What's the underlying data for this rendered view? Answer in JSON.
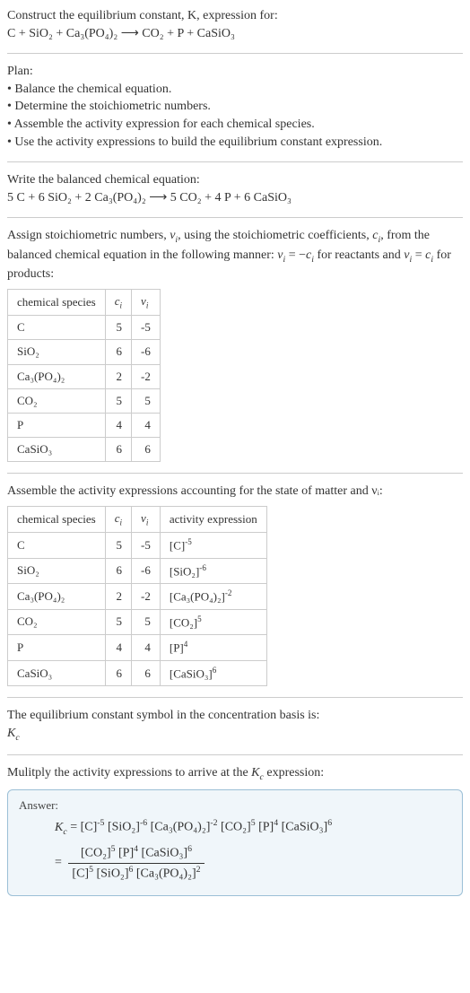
{
  "intro": {
    "line1": "Construct the equilibrium constant, K, expression for:",
    "eq": "C + SiO₂ + Ca₃(PO₄)₂  ⟶  CO₂ + P + CaSiO₃"
  },
  "plan": {
    "title": "Plan:",
    "items": [
      "• Balance the chemical equation.",
      "• Determine the stoichiometric numbers.",
      "• Assemble the activity expression for each chemical species.",
      "• Use the activity expressions to build the equilibrium constant expression."
    ]
  },
  "balanced": {
    "title": "Write the balanced chemical equation:",
    "eq": "5 C + 6 SiO₂ + 2 Ca₃(PO₄)₂  ⟶  5 CO₂ + 4 P + 6 CaSiO₃"
  },
  "stoich": {
    "desc_a": "Assign stoichiometric numbers, ",
    "desc_b": ", using the stoichiometric coefficients, ",
    "desc_c": ", from the balanced chemical equation in the following manner: ",
    "desc_d": " for reactants and ",
    "desc_e": " for products:",
    "headers": {
      "species": "chemical species",
      "ci": "cᵢ",
      "vi": "νᵢ"
    },
    "rows": [
      {
        "sp": "C",
        "c": "5",
        "v": "-5"
      },
      {
        "sp": "SiO₂",
        "c": "6",
        "v": "-6"
      },
      {
        "sp": "Ca₃(PO₄)₂",
        "c": "2",
        "v": "-2"
      },
      {
        "sp": "CO₂",
        "c": "5",
        "v": "5"
      },
      {
        "sp": "P",
        "c": "4",
        "v": "4"
      },
      {
        "sp": "CaSiO₃",
        "c": "6",
        "v": "6"
      }
    ]
  },
  "activity": {
    "desc": "Assemble the activity expressions accounting for the state of matter and νᵢ:",
    "headers": {
      "species": "chemical species",
      "ci": "cᵢ",
      "vi": "νᵢ",
      "act": "activity expression"
    },
    "rows": [
      {
        "sp": "C",
        "c": "5",
        "v": "-5",
        "a_base": "[C]",
        "a_exp": "-5"
      },
      {
        "sp": "SiO₂",
        "c": "6",
        "v": "-6",
        "a_base": "[SiO₂]",
        "a_exp": "-6"
      },
      {
        "sp": "Ca₃(PO₄)₂",
        "c": "2",
        "v": "-2",
        "a_base": "[Ca₃(PO₄)₂]",
        "a_exp": "-2"
      },
      {
        "sp": "CO₂",
        "c": "5",
        "v": "5",
        "a_base": "[CO₂]",
        "a_exp": "5"
      },
      {
        "sp": "P",
        "c": "4",
        "v": "4",
        "a_base": "[P]",
        "a_exp": "4"
      },
      {
        "sp": "CaSiO₃",
        "c": "6",
        "v": "6",
        "a_base": "[CaSiO₃]",
        "a_exp": "6"
      }
    ]
  },
  "symbol": {
    "line1": "The equilibrium constant symbol in the concentration basis is:",
    "line2": "K꜀"
  },
  "final": {
    "title": "Mulitply the activity expressions to arrive at the K꜀ expression:",
    "answer_label": "Answer:",
    "kc": "K꜀ = ",
    "prod": {
      "t1": "[C]",
      "e1": "-5",
      "t2": "[SiO₂]",
      "e2": "-6",
      "t3": "[Ca₃(PO₄)₂]",
      "e3": "-2",
      "t4": "[CO₂]",
      "e4": "5",
      "t5": "[P]",
      "e5": "4",
      "t6": "[CaSiO₃]",
      "e6": "6"
    },
    "frac": {
      "num": {
        "t1": "[CO₂]",
        "e1": "5",
        "t2": "[P]",
        "e2": "4",
        "t3": "[CaSiO₃]",
        "e3": "6"
      },
      "den": {
        "t1": "[C]",
        "e1": "5",
        "t2": "[SiO₂]",
        "e2": "6",
        "t3": "[Ca₃(PO₄)₂]",
        "e3": "2"
      }
    }
  }
}
